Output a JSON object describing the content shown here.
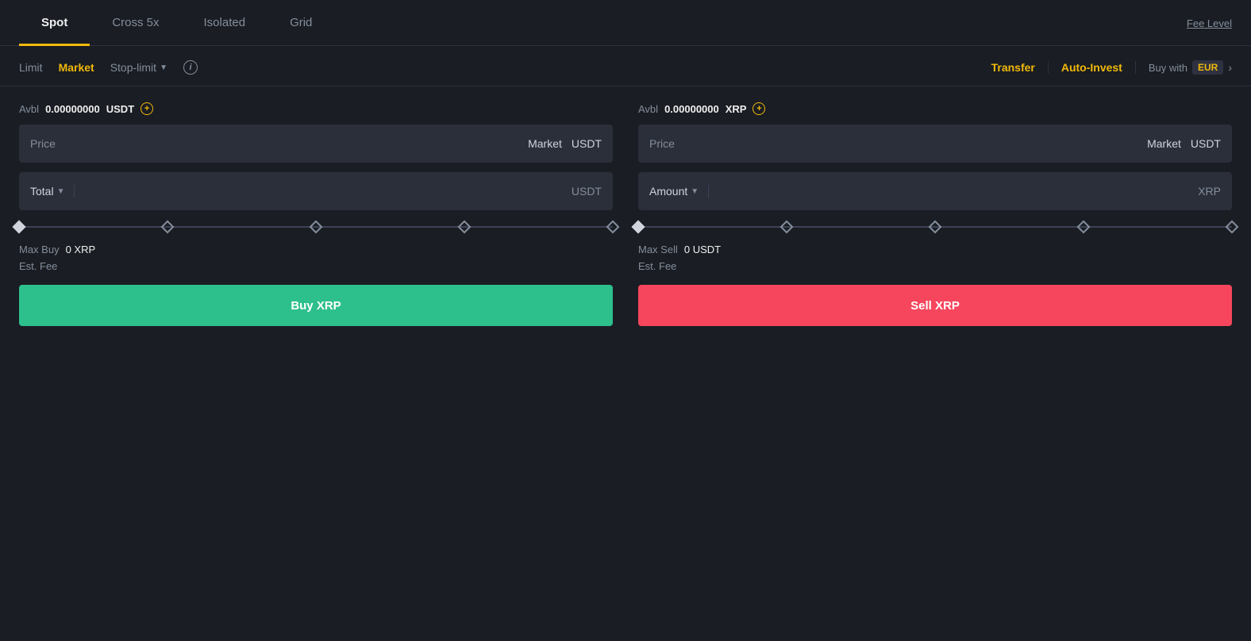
{
  "tabs": {
    "items": [
      {
        "id": "spot",
        "label": "Spot",
        "active": true
      },
      {
        "id": "cross5x",
        "label": "Cross 5x",
        "active": false
      },
      {
        "id": "isolated",
        "label": "Isolated",
        "active": false
      },
      {
        "id": "grid",
        "label": "Grid",
        "active": false
      }
    ],
    "fee_level": "Fee Level"
  },
  "order_types": {
    "limit": "Limit",
    "market": "Market",
    "stop_limit": "Stop-limit",
    "info_icon": "i"
  },
  "right_actions": {
    "transfer": "Transfer",
    "auto_invest": "Auto-Invest",
    "buy_with": "Buy with",
    "currency": "EUR"
  },
  "buy_side": {
    "avbl_label": "Avbl",
    "avbl_amount": "0.00000000",
    "avbl_currency": "USDT",
    "price_placeholder": "Price",
    "price_market": "Market",
    "price_currency": "USDT",
    "total_label": "Total",
    "total_currency": "USDT",
    "max_buy_label": "Max Buy",
    "max_buy_value": "0 XRP",
    "est_fee_label": "Est. Fee",
    "button_label": "Buy XRP"
  },
  "sell_side": {
    "avbl_label": "Avbl",
    "avbl_amount": "0.00000000",
    "avbl_currency": "XRP",
    "price_placeholder": "Price",
    "price_market": "Market",
    "price_currency": "USDT",
    "amount_label": "Amount",
    "amount_currency": "XRP",
    "max_sell_label": "Max Sell",
    "max_sell_value": "0 USDT",
    "est_fee_label": "Est. Fee",
    "button_label": "Sell XRP"
  }
}
